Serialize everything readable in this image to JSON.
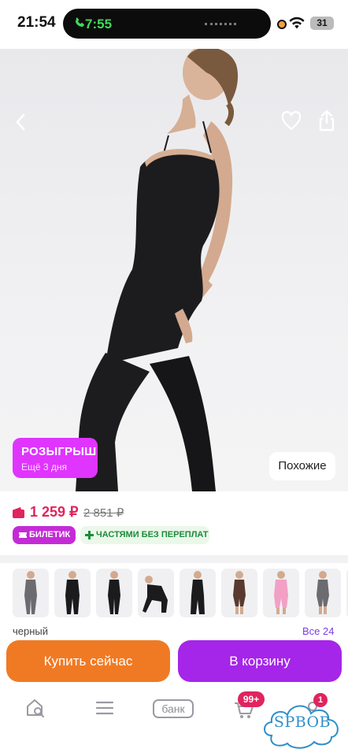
{
  "status_bar": {
    "time": "21:54",
    "call_time": "7:55",
    "battery": "31"
  },
  "product": {
    "giveaway_title": "РОЗЫГРЫШ",
    "giveaway_sub": "Ещё 3 дня",
    "similar_label": "Похожие",
    "price": "1 259 ₽",
    "old_price": "2 851 ₽",
    "ticket_badge": "БИЛЕТИК",
    "installments_badge": "ЧАСТЯМИ БЕЗ ПЕРЕПЛАТ"
  },
  "variants": {
    "color_label": "черный",
    "all_link": "Все 24",
    "items": [
      {
        "name": "variant-1",
        "color": "#6b6b70"
      },
      {
        "name": "variant-2",
        "color": "#1b1b1d"
      },
      {
        "name": "variant-3",
        "color": "#1b1b1d"
      },
      {
        "name": "variant-4",
        "color": "#1b1b1d"
      },
      {
        "name": "variant-5",
        "color": "#1b1b1d"
      },
      {
        "name": "variant-6",
        "color": "#5a3a2e"
      },
      {
        "name": "variant-7",
        "color": "#f2a0c6"
      },
      {
        "name": "variant-8",
        "color": "#6b6b70"
      }
    ]
  },
  "actions": {
    "buy_now": "Купить сейчас",
    "add_to_cart": "В корзину"
  },
  "tabbar": {
    "bank_label": "банк",
    "cart_badge": "99+",
    "profile_badge": "1"
  },
  "watermark": {
    "text": "SPBOB"
  },
  "colors": {
    "accent_purple": "#a525e9",
    "buy_orange": "#f07a24",
    "price_red": "#e0245e",
    "giveaway_pink": "#e034ff"
  }
}
